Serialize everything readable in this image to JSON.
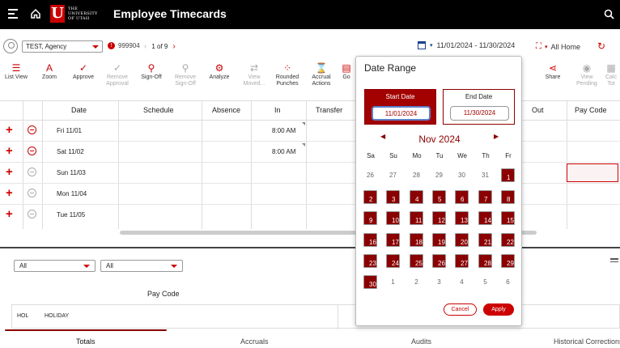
{
  "header": {
    "app_title": "Employee Timecards",
    "logo_text_lines": [
      "THE",
      "UNIVERSITY",
      "OF UTAH"
    ]
  },
  "employee": {
    "name": "TEST, Agency",
    "id": "999904",
    "pager": "1 of 9"
  },
  "range_label": "11/01/2024 - 11/30/2024",
  "home_label": "All Home",
  "tools": [
    {
      "label": "List View",
      "icon": "list-icon",
      "enabled": true
    },
    {
      "label": "Zoom",
      "icon": "zoom-icon",
      "enabled": true
    },
    {
      "label": "Approve",
      "icon": "check-icon",
      "enabled": true
    },
    {
      "label": "Remove Approval",
      "icon": "remove-approval-icon",
      "enabled": false
    },
    {
      "label": "Sign-Off",
      "icon": "sign-off-icon",
      "enabled": true
    },
    {
      "label": "Remove Sign-Off",
      "icon": "remove-signoff-icon",
      "enabled": false
    },
    {
      "label": "Analyze",
      "icon": "analyze-icon",
      "enabled": true
    },
    {
      "label": "View Moved...",
      "icon": "view-moved-icon",
      "enabled": false
    },
    {
      "label": "Rounded Punches",
      "icon": "rounded-punches-icon",
      "enabled": true
    },
    {
      "label": "Accrual Actions",
      "icon": "accrual-icon",
      "enabled": true
    },
    {
      "label": "Go",
      "icon": "go-icon",
      "enabled": true
    },
    {
      "label": "Share",
      "icon": "share-icon",
      "enabled": true
    },
    {
      "label": "View Pending",
      "icon": "pending-icon",
      "enabled": false
    },
    {
      "label": "Calc Tot",
      "icon": "calc-icon",
      "enabled": false
    }
  ],
  "grid": {
    "headers": [
      "Date",
      "Schedule",
      "Absence",
      "In",
      "Transfer",
      "Out",
      "Pay Code"
    ],
    "rows": [
      {
        "date": "Fri 11/01",
        "in": "8:00 AM",
        "removable": true
      },
      {
        "date": "Sat 11/02",
        "in": "8:00 AM",
        "removable": true
      },
      {
        "date": "Sun 11/03",
        "in": "",
        "removable": false
      },
      {
        "date": "Mon 11/04",
        "in": "",
        "removable": false
      },
      {
        "date": "Tue 11/05",
        "in": "",
        "removable": false
      }
    ]
  },
  "bottom": {
    "filter1": "All",
    "filter2": "All",
    "paycode_header": "Pay Code",
    "row": {
      "code": "HOL",
      "name": "HOLIDAY"
    },
    "tabs": [
      "Totals",
      "Accruals",
      "Audits",
      "Historical Corrections"
    ]
  },
  "date_range": {
    "title": "Date Range",
    "start_label": "Start Date",
    "start_value": "11/01/2024",
    "end_label": "End Date",
    "end_value": "11/30/2024",
    "month_title": "Nov 2024",
    "weekdays": [
      "Sa",
      "Su",
      "Mo",
      "Tu",
      "We",
      "Th",
      "Fr"
    ],
    "weeks": [
      [
        "26",
        "27",
        "28",
        "29",
        "30",
        "31",
        "1"
      ],
      [
        "2",
        "3",
        "4",
        "5",
        "6",
        "7",
        "8"
      ],
      [
        "9",
        "10",
        "11",
        "12",
        "13",
        "14",
        "15"
      ],
      [
        "16",
        "17",
        "18",
        "19",
        "20",
        "21",
        "22"
      ],
      [
        "23",
        "24",
        "25",
        "26",
        "27",
        "28",
        "29"
      ],
      [
        "30",
        "1",
        "2",
        "3",
        "4",
        "5",
        "6"
      ]
    ],
    "cancel_label": "Cancel",
    "apply_label": "Apply"
  },
  "colors": {
    "accent": "#cc0000",
    "selected_day": "#8b0000",
    "header_bg": "#000000"
  }
}
